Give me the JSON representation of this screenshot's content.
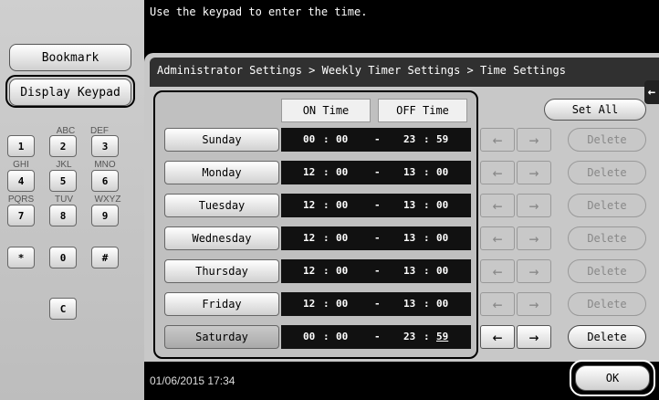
{
  "message": "Use the keypad to enter the time.",
  "left_panel": {
    "bookmark_label": "Bookmark",
    "display_keypad_label": "Display Keypad",
    "keypad": {
      "k1": "1",
      "k2": "2",
      "k3": "3",
      "k4": "4",
      "k5": "5",
      "k6": "6",
      "k7": "7",
      "k8": "8",
      "k9": "9",
      "kstar": "*",
      "k0": "0",
      "khash": "#",
      "kc": "C",
      "sub2": "ABC",
      "sub3": "DEF",
      "sub4": "GHI",
      "sub5": "JKL",
      "sub6": "MNO",
      "sub7": "PQRS",
      "sub8": "TUV",
      "sub9": "WXYZ"
    }
  },
  "breadcrumb": "Administrator Settings > Weekly Timer Settings > Time Settings",
  "back_icon": "left-arrow",
  "headers": {
    "on": "ON Time",
    "off": "OFF Time"
  },
  "set_all_label": "Set All",
  "rows": {
    "r0": {
      "day": "Sunday",
      "on_h": "00",
      "on_m": "00",
      "off_h": "23",
      "off_m": "59"
    },
    "r1": {
      "day": "Monday",
      "on_h": "12",
      "on_m": "00",
      "off_h": "13",
      "off_m": "00"
    },
    "r2": {
      "day": "Tuesday",
      "on_h": "12",
      "on_m": "00",
      "off_h": "13",
      "off_m": "00"
    },
    "r3": {
      "day": "Wednesday",
      "on_h": "12",
      "on_m": "00",
      "off_h": "13",
      "off_m": "00"
    },
    "r4": {
      "day": "Thursday",
      "on_h": "12",
      "on_m": "00",
      "off_h": "13",
      "off_m": "00"
    },
    "r5": {
      "day": "Friday",
      "on_h": "12",
      "on_m": "00",
      "off_h": "13",
      "off_m": "00"
    },
    "r6": {
      "day": "Saturday",
      "on_h": "00",
      "on_m": "00",
      "off_h": "23",
      "off_m": "59"
    }
  },
  "time_sep": ":",
  "range_sep": "-",
  "left_arrow": "←",
  "right_arrow": "→",
  "delete_label": "Delete",
  "selected_day": "Saturday",
  "datetime": "01/06/2015  17:34",
  "ok_label": "OK"
}
